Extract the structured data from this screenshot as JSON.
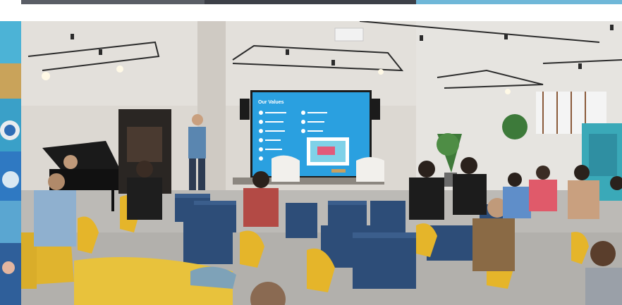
{
  "scene": {
    "screen_title": "Our Values"
  },
  "colors": {
    "wall": "#d9d5cf",
    "floor": "#b9b7b3",
    "screen": "#2aa0e0",
    "stool": "#2d4d78",
    "chair": "#e5b52a",
    "sofa": "#e8c23c"
  }
}
